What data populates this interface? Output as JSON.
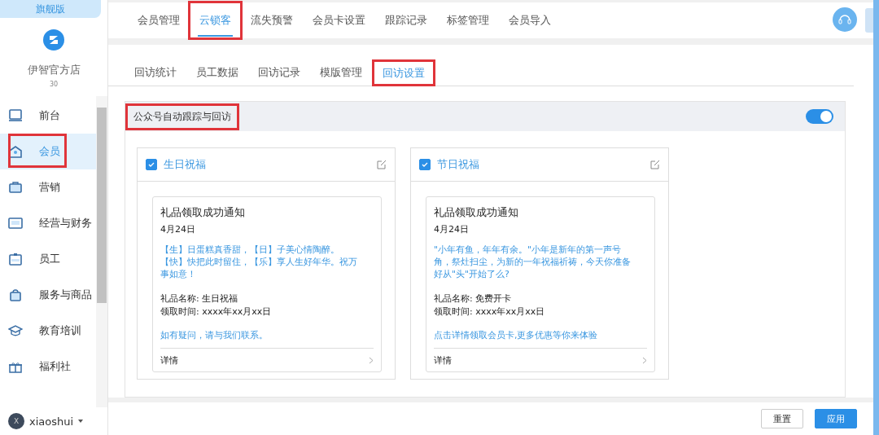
{
  "sidebar": {
    "edition": "旗舰版",
    "store_name": "伊智官方店",
    "store_count": "30",
    "items": [
      {
        "label": "前台",
        "selected": false,
        "highlighted": false
      },
      {
        "label": "会员",
        "selected": true,
        "highlighted": true
      },
      {
        "label": "营销",
        "selected": false,
        "highlighted": false
      },
      {
        "label": "经营与财务",
        "selected": false,
        "highlighted": false
      },
      {
        "label": "员工",
        "selected": false,
        "highlighted": false
      },
      {
        "label": "服务与商品",
        "selected": false,
        "highlighted": false
      },
      {
        "label": "教育培训",
        "selected": false,
        "highlighted": false
      },
      {
        "label": "福利社",
        "selected": false,
        "highlighted": false
      }
    ],
    "user": {
      "avatar": "X",
      "name": "xiaoshui"
    }
  },
  "tabs": [
    {
      "label": "会员管理",
      "selected": false,
      "highlighted": false
    },
    {
      "label": "云锁客",
      "selected": true,
      "highlighted": true
    },
    {
      "label": "流失预警",
      "selected": false,
      "highlighted": false
    },
    {
      "label": "会员卡设置",
      "selected": false,
      "highlighted": false
    },
    {
      "label": "跟踪记录",
      "selected": false,
      "highlighted": false
    },
    {
      "label": "标签管理",
      "selected": false,
      "highlighted": false
    },
    {
      "label": "会员导入",
      "selected": false,
      "highlighted": false
    }
  ],
  "subtabs": [
    {
      "label": "回访统计",
      "selected": false,
      "highlighted": false
    },
    {
      "label": "员工数据",
      "selected": false,
      "highlighted": false
    },
    {
      "label": "回访记录",
      "selected": false,
      "highlighted": false
    },
    {
      "label": "模版管理",
      "selected": false,
      "highlighted": false
    },
    {
      "label": "回访设置",
      "selected": true,
      "highlighted": true
    }
  ],
  "panel": {
    "title": "公众号自动跟踪与回访",
    "highlighted": true,
    "on": true,
    "cards": [
      {
        "title": "生日祝福",
        "checked": true,
        "message": {
          "title": "礼品领取成功通知",
          "date": "4月24日",
          "greeting": "【生】日蛋糕真香甜，【日】子美心情陶醉。【快】快把此时留住，【乐】享人生好年华。祝万事如意！",
          "gift": "礼品名称: 生日祝福",
          "time": "领取时间: xxxx年xx月xx日",
          "note": "如有疑问，请与我们联系。",
          "details": "详情"
        }
      },
      {
        "title": "节日祝福",
        "checked": true,
        "message": {
          "title": "礼品领取成功通知",
          "date": "4月24日",
          "greeting": "\"小年有鱼，年年有余。\"小年是新年的第一声号角，祭灶扫尘，为新的一年祝福祈祷，今天你准备好从\"头\"开始了么?",
          "gift": "礼品名称: 免费开卡",
          "time": "领取时间: xxxx年xx月xx日",
          "note": "点击详情领取会员卡,更多优惠等你来体验",
          "details": "详情"
        }
      }
    ]
  },
  "footer": {
    "buttons": [
      {
        "label": "重置",
        "kind": "secondary"
      },
      {
        "label": "应用",
        "kind": "primary"
      }
    ]
  }
}
